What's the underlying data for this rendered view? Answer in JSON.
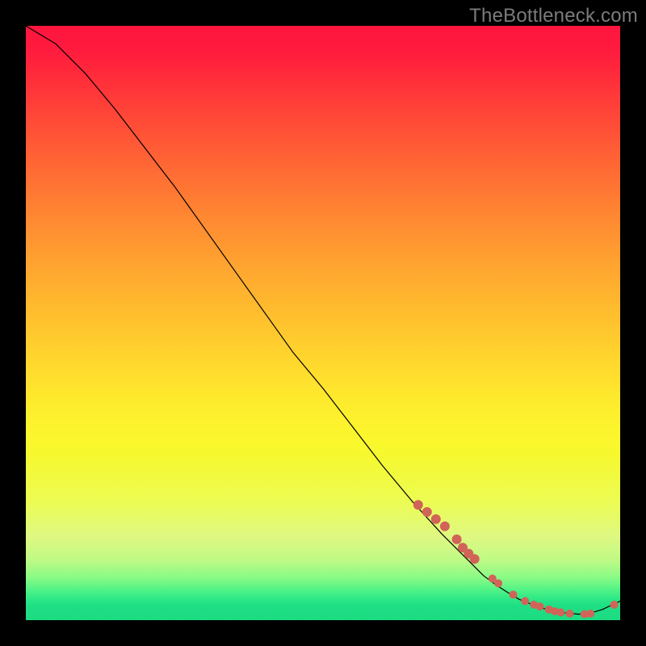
{
  "watermark": "TheBottleneck.com",
  "chart_data": {
    "type": "line",
    "title": "",
    "xlabel": "",
    "ylabel": "",
    "xlim": [
      0,
      100
    ],
    "ylim": [
      0,
      100
    ],
    "background_gradient": {
      "top_color": "#ff153f",
      "mid_color": "#ffe12d",
      "bottom_color": "#1cdb82"
    },
    "series": [
      {
        "name": "curve",
        "x": [
          0,
          5,
          10,
          15,
          20,
          25,
          30,
          35,
          40,
          45,
          50,
          55,
          60,
          65,
          70,
          75,
          77,
          79,
          81,
          83,
          85,
          87,
          89,
          91,
          93,
          95,
          97,
          100
        ],
        "values": [
          100,
          97,
          92,
          86,
          79.5,
          73,
          66,
          59,
          52,
          45,
          39,
          32.5,
          26,
          20,
          14.5,
          9.5,
          7.5,
          6.0,
          4.7,
          3.5,
          2.7,
          2.0,
          1.5,
          1.2,
          1.0,
          1.2,
          1.8,
          3.2
        ]
      }
    ],
    "markers": {
      "name": "highlight-points",
      "color": "#d16458",
      "radius_large": 6,
      "radius_small": 5,
      "x": [
        66,
        67.5,
        69,
        70.5,
        72.5,
        73.5,
        74.5,
        75.5,
        78.5,
        79.5,
        82,
        84,
        85.5,
        86.5,
        88,
        89,
        90,
        91.5,
        94,
        95,
        99
      ],
      "values": [
        19.4,
        18.2,
        17.0,
        15.8,
        13.6,
        12.2,
        11.2,
        10.3,
        7.0,
        6.2,
        4.3,
        3.2,
        2.6,
        2.3,
        1.8,
        1.5,
        1.3,
        1.1,
        1.0,
        1.1,
        2.6
      ],
      "size": [
        "L",
        "L",
        "L",
        "L",
        "L",
        "L",
        "L",
        "L",
        "S",
        "S",
        "S",
        "S",
        "S",
        "S",
        "S",
        "S",
        "S",
        "S",
        "S",
        "S",
        "S"
      ]
    }
  }
}
